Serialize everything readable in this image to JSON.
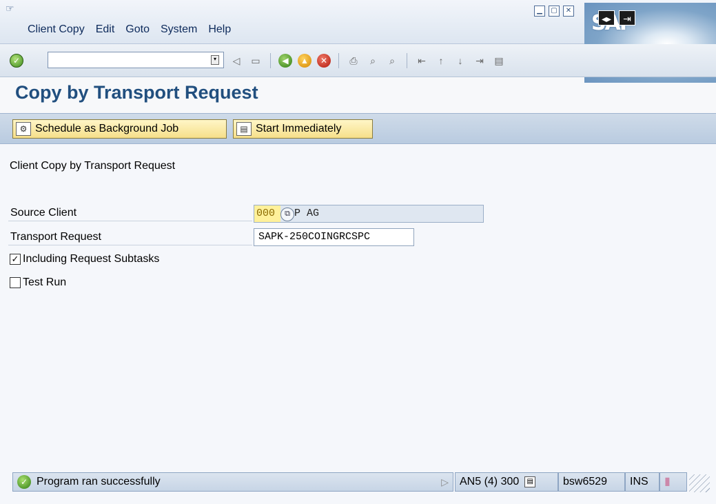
{
  "menubar": {
    "items": [
      "Client Copy",
      "Edit",
      "Goto",
      "System",
      "Help"
    ]
  },
  "window_buttons": [
    "minimize",
    "maximize",
    "close"
  ],
  "logo": {
    "text": "SAP"
  },
  "toolbar": {
    "command_placeholder": "",
    "icons": [
      "back-icon",
      "save-icon",
      "green-back-icon",
      "exit-icon",
      "cancel-icon",
      "print-icon",
      "find-icon",
      "find-next-icon",
      "first-page-icon",
      "prev-page-icon",
      "next-page-icon",
      "last-page-icon",
      "layout-icon"
    ]
  },
  "page": {
    "title": "Copy by Transport Request"
  },
  "app_toolbar": {
    "schedule_label": "Schedule as Background Job",
    "start_label": "Start Immediately"
  },
  "form": {
    "frame_label": "Client Copy by Transport Request",
    "source_client_label": "Source Client",
    "source_client_value": "000",
    "source_client_name": "P AG",
    "transport_request_label": "Transport Request",
    "transport_request_value": "SAPK-250COINGRCSPC",
    "including_subtasks_label": "Including Request Subtasks",
    "including_subtasks_checked": true,
    "test_run_label": "Test Run",
    "test_run_checked": false
  },
  "status": {
    "message": "Program ran successfully",
    "system": "AN5 (4) 300",
    "server": "bsw6529",
    "mode": "INS"
  },
  "colors": {
    "title": "#214f7f",
    "app_button": "#f6df8a",
    "toolbar_bg": "#d9e2ed"
  }
}
